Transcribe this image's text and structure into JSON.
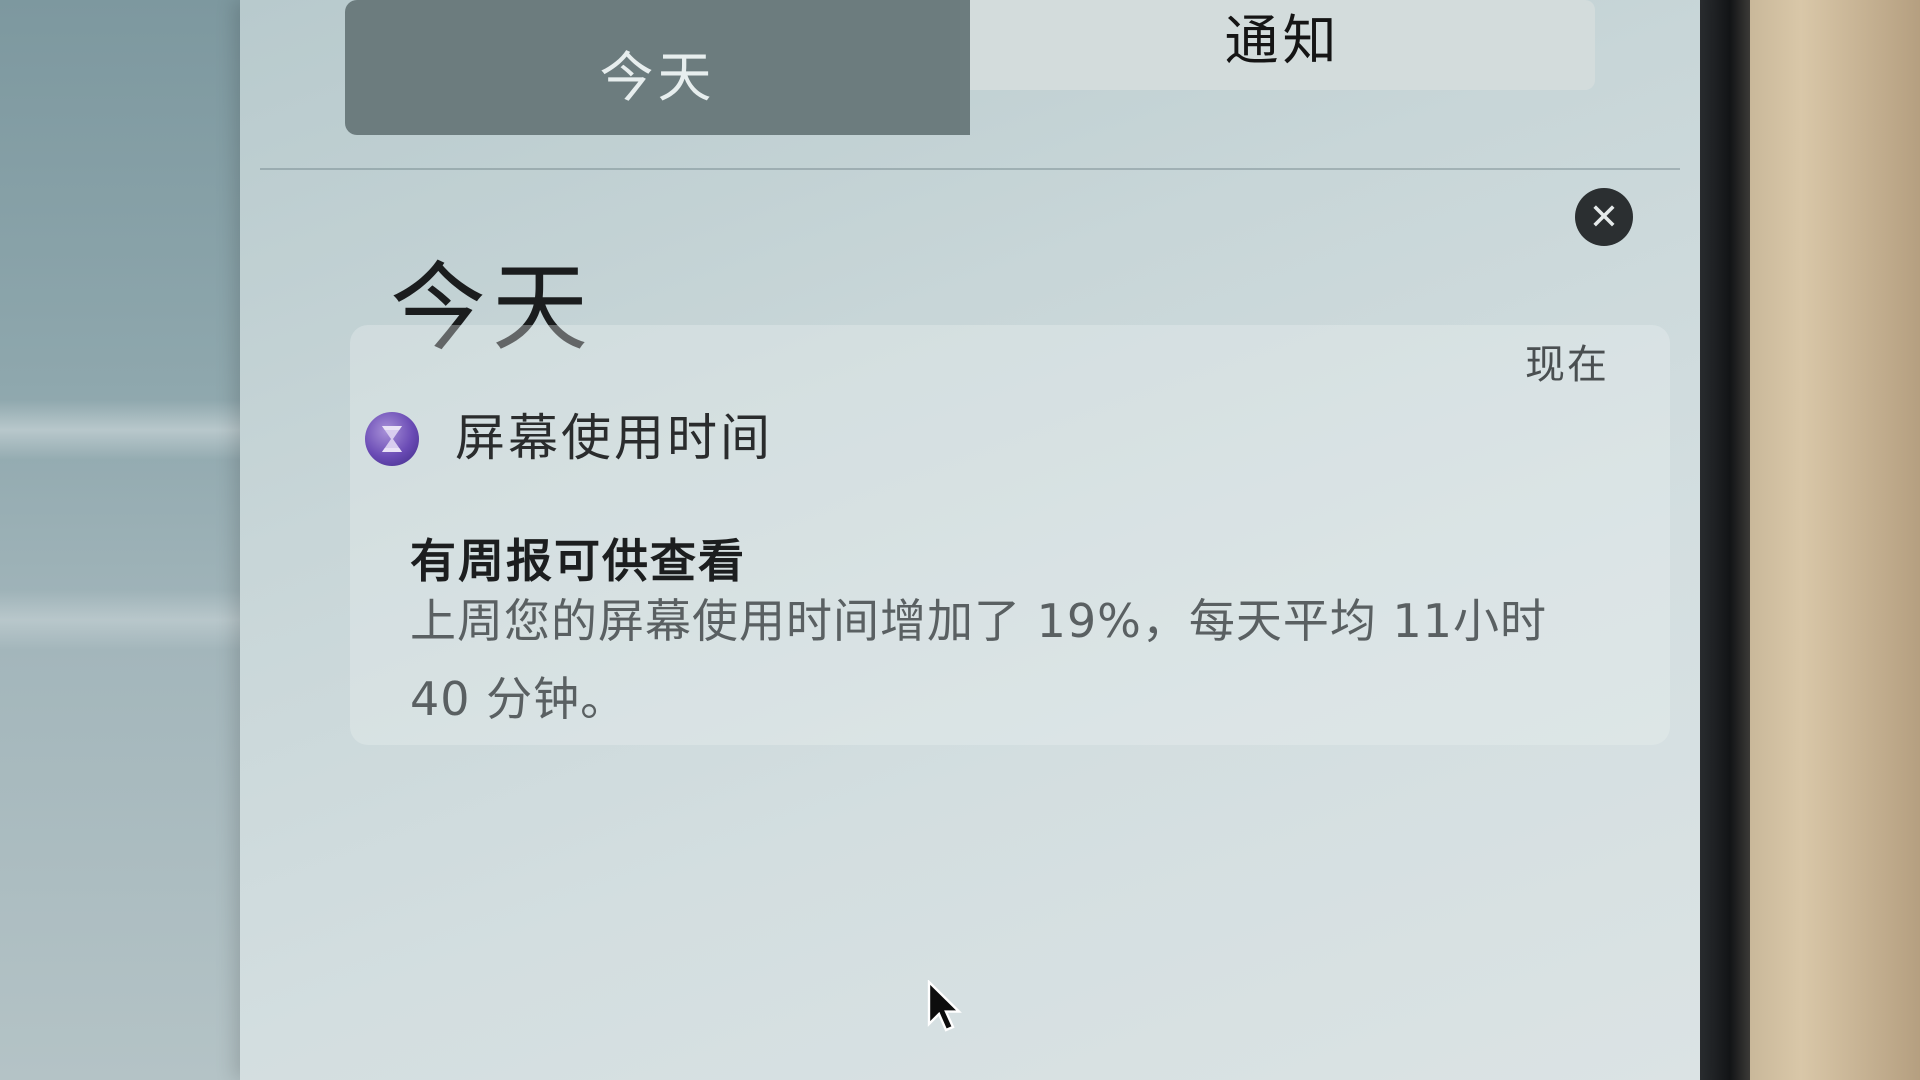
{
  "tabs": [
    {
      "label": "今天",
      "selected": true
    },
    {
      "label": "通知",
      "selected": false
    }
  ],
  "section": {
    "title": "今天"
  },
  "notification": {
    "app_icon": "hourglass-icon",
    "app_name": "屏幕使用时间",
    "timestamp": "现在",
    "title": "有周报可供查看",
    "body": "上周您的屏幕使用时间增加了 19%，每天平均 11小时 40 分钟。"
  },
  "close_icon": "close-icon",
  "colors": {
    "tab_selected_bg": "#6c7c7e",
    "tab_unselected_bg": "#d3dcdc",
    "panel_bg": "#c8d6d8",
    "app_icon": "#6a4bb5",
    "close_button": "#2b2f31"
  }
}
